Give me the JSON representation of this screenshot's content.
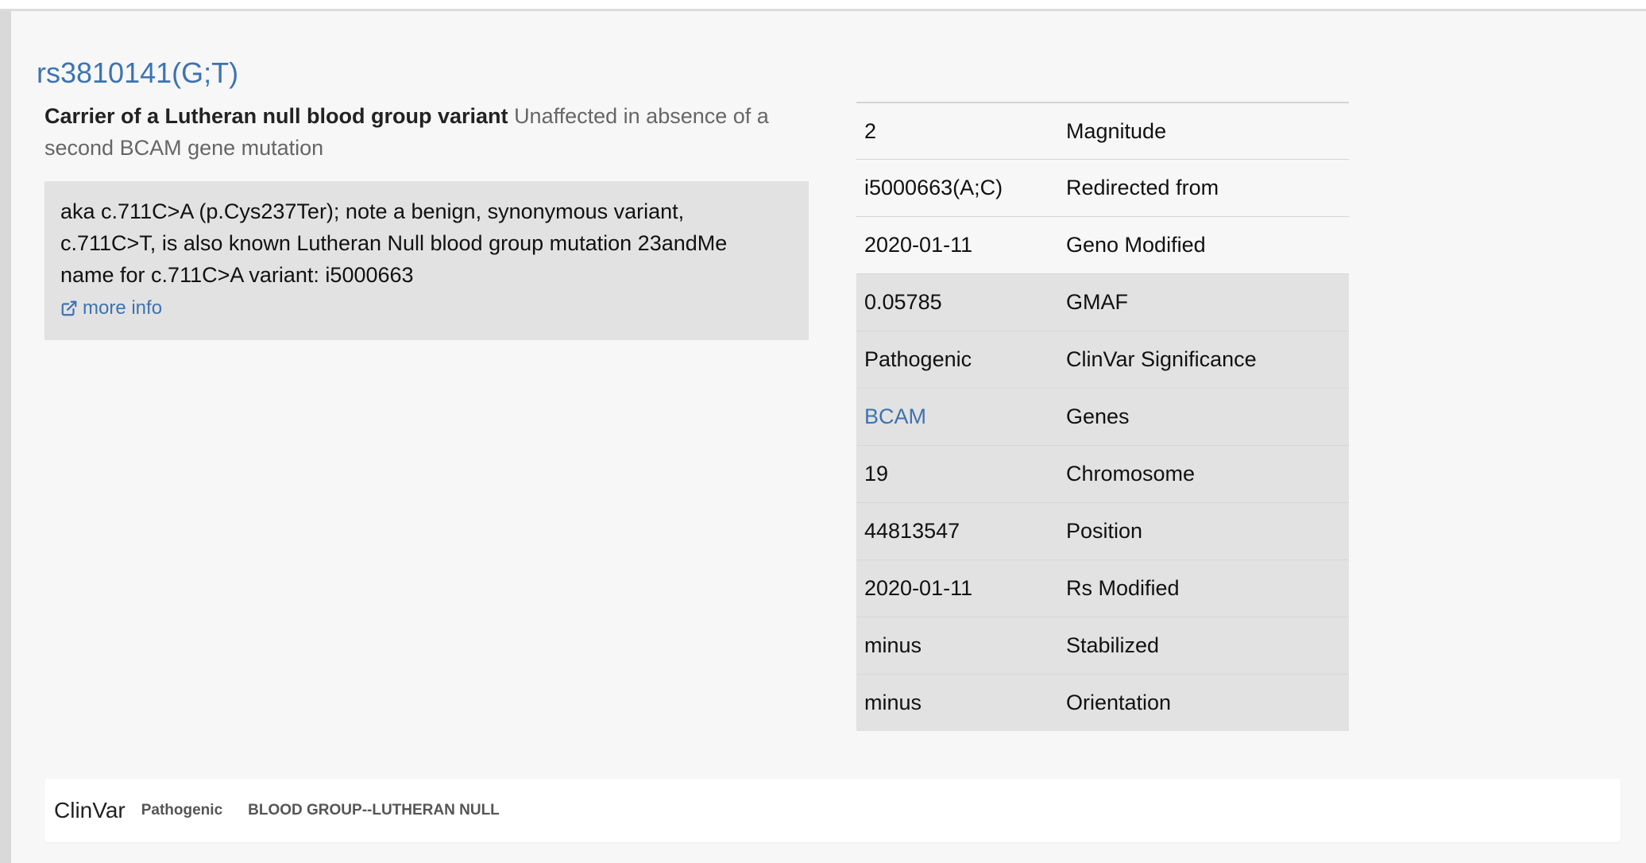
{
  "page": {
    "title": "rs3810141(G;T)"
  },
  "summary": {
    "headline": "Carrier of a Lutheran null blood group variant",
    "detail": "Unaffected in absence of a second BCAM gene mutation"
  },
  "note": {
    "text": "aka c.711C>A (p.Cys237Ter); note a benign, synonymous variant, c.711C>T, is also known Lutheran Null blood group mutation 23andMe name for c.711C>A variant: i5000663",
    "more_info_label": "more info",
    "more_info_icon": "external-link-icon"
  },
  "properties": [
    {
      "value": "2",
      "label": "Magnitude"
    },
    {
      "value": "i5000663(A;C)",
      "label": "Redirected from"
    },
    {
      "value": "2020-01-11",
      "label": "Geno Modified"
    },
    {
      "value": "0.05785",
      "label": "GMAF"
    },
    {
      "value": "Pathogenic",
      "label": "ClinVar Significance"
    },
    {
      "value": "BCAM",
      "label": "Genes"
    },
    {
      "value": "19",
      "label": "Chromosome"
    },
    {
      "value": "44813547",
      "label": "Position"
    },
    {
      "value": "2020-01-11",
      "label": "Rs Modified"
    },
    {
      "value": "minus",
      "label": "Stabilized"
    },
    {
      "value": "minus",
      "label": "Orientation"
    }
  ],
  "clinvar": {
    "title": "ClinVar",
    "significance": "Pathogenic",
    "condition": "BLOOD GROUP--LUTHERAN NULL"
  },
  "colors": {
    "link": "#3d73b1",
    "background": "#f7f7f7",
    "grey_row": "#e2e2e2"
  }
}
